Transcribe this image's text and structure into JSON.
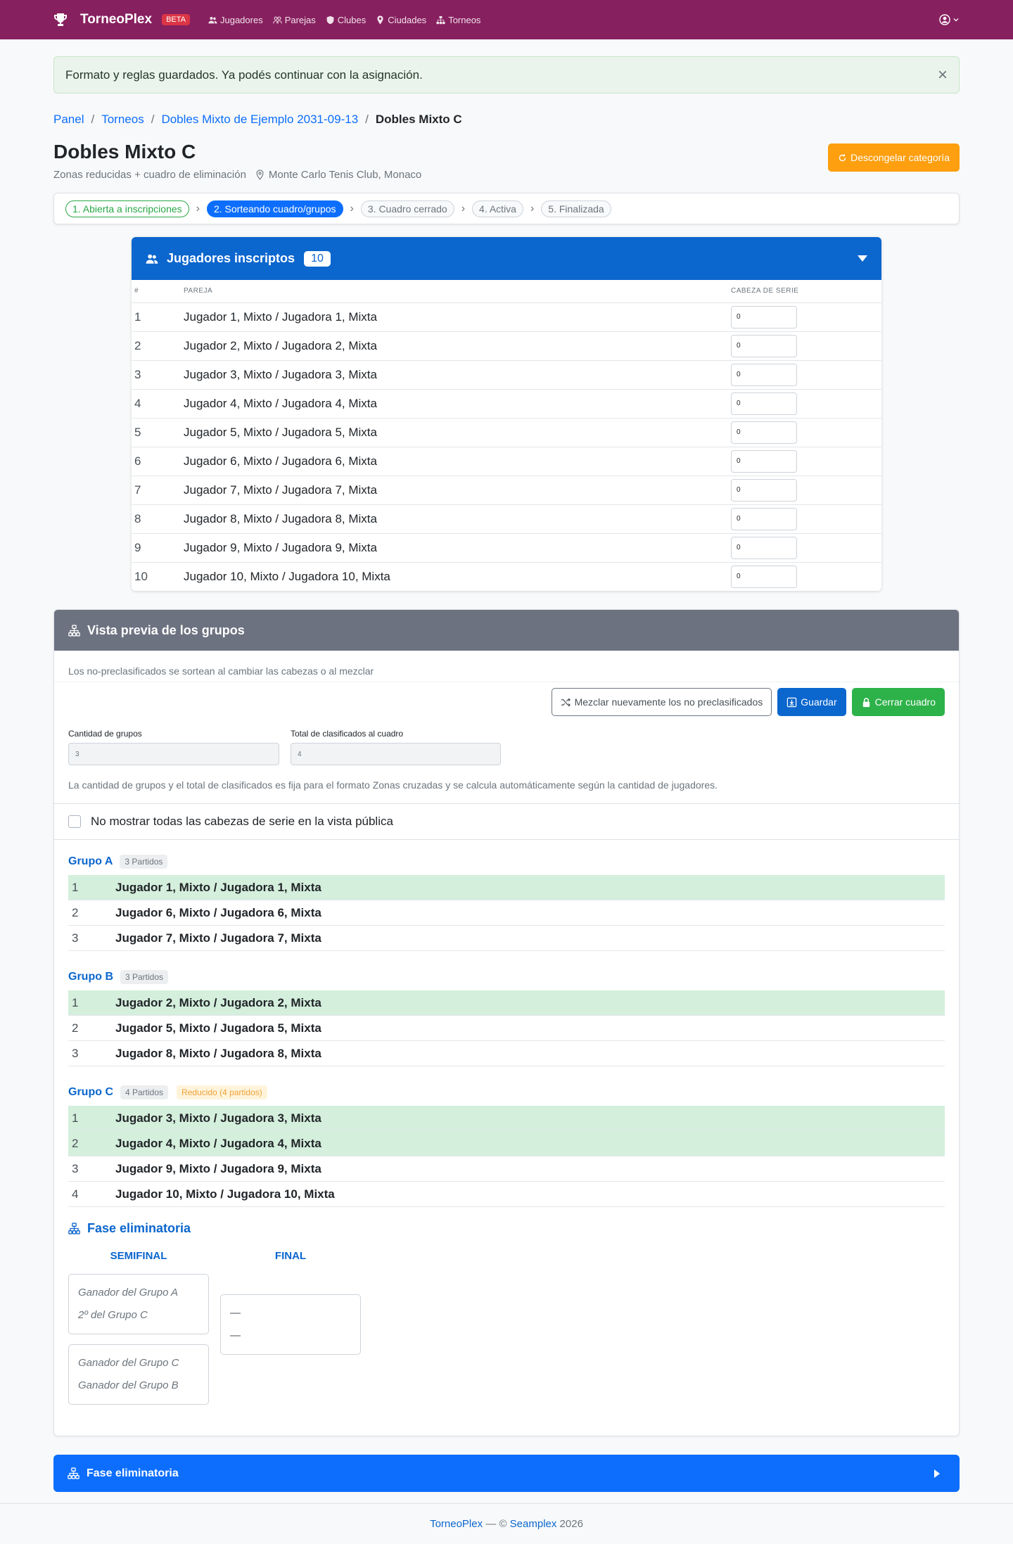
{
  "nav": {
    "brand": "TorneoPlex",
    "beta": "BETA",
    "items": [
      {
        "label": "Jugadores",
        "icon": "people-icon"
      },
      {
        "label": "Parejas",
        "icon": "pair-icon"
      },
      {
        "label": "Clubes",
        "icon": "shield-icon"
      },
      {
        "label": "Ciudades",
        "icon": "pin-icon"
      },
      {
        "label": "Torneos",
        "icon": "bracket-icon"
      }
    ],
    "user_icon": "user-circle-icon"
  },
  "alert": {
    "text": "Formato y reglas guardados. Ya podés continuar con la asignación.",
    "close": "×"
  },
  "breadcrumb": {
    "panel": "Panel",
    "torneos": "Torneos",
    "torneo": "Dobles Mixto de Ejemplo 2031-09-13",
    "current": "Dobles Mixto C",
    "sep": "/"
  },
  "header": {
    "title": "Dobles Mixto C",
    "format": "Zonas reducidas + cuadro de eliminación",
    "venue": "Monte Carlo Tenis Club, Monaco",
    "unfreeze_button": "Descongelar categoría"
  },
  "steps": [
    {
      "label": "1. Abierta a inscripciones",
      "state": "done"
    },
    {
      "label": "2. Sorteando cuadro/grupos",
      "state": "current"
    },
    {
      "label": "3. Cuadro cerrado",
      "state": "pending"
    },
    {
      "label": "4. Activa",
      "state": "pending"
    },
    {
      "label": "5. Finalizada",
      "state": "pending"
    }
  ],
  "players": {
    "title": "Jugadores inscriptos",
    "count": "10",
    "columns": {
      "num": "#",
      "pair": "PAREJA",
      "seed": "CABEZA DE SERIE"
    },
    "rows": [
      {
        "num": "1",
        "pair": "Jugador 1, Mixto / Jugadora 1, Mixta",
        "seed": "0"
      },
      {
        "num": "2",
        "pair": "Jugador 2, Mixto / Jugadora 2, Mixta",
        "seed": "0"
      },
      {
        "num": "3",
        "pair": "Jugador 3, Mixto / Jugadora 3, Mixta",
        "seed": "0"
      },
      {
        "num": "4",
        "pair": "Jugador 4, Mixto / Jugadora 4, Mixta",
        "seed": "0"
      },
      {
        "num": "5",
        "pair": "Jugador 5, Mixto / Jugadora 5, Mixta",
        "seed": "0"
      },
      {
        "num": "6",
        "pair": "Jugador 6, Mixto / Jugadora 6, Mixta",
        "seed": "0"
      },
      {
        "num": "7",
        "pair": "Jugador 7, Mixto / Jugadora 7, Mixta",
        "seed": "0"
      },
      {
        "num": "8",
        "pair": "Jugador 8, Mixto / Jugadora 8, Mixta",
        "seed": "0"
      },
      {
        "num": "9",
        "pair": "Jugador 9, Mixto / Jugadora 9, Mixta",
        "seed": "0"
      },
      {
        "num": "10",
        "pair": "Jugador 10, Mixto / Jugadora 10, Mixta",
        "seed": "0"
      }
    ]
  },
  "preview": {
    "title": "Vista previa de los grupos",
    "hint": "Los no-preclasificados se sortean al cambiar las cabezas o al mezclar",
    "shuffle_button": "Mezclar nuevamente los no preclasificados",
    "save_button": "Guardar",
    "close_button": "Cerrar cuadro",
    "groups_label": "Cantidad de grupos",
    "groups_value": "3",
    "qualified_label": "Total de clasificados al cuadro",
    "qualified_value": "4",
    "help": "La cantidad de grupos y el total de clasificados es fija para el formato Zonas cruzadas y se calcula automáticamente según la cantidad de jugadores.",
    "hide_seeds_label": "No mostrar todas las cabezas de serie en la vista pública",
    "groups": [
      {
        "name": "Grupo A",
        "matches": "3 Partidos",
        "reduced": "",
        "rows": [
          {
            "pos": "1",
            "name": "Jugador 1, Mixto / Jugadora 1, Mixta",
            "qualified": true
          },
          {
            "pos": "2",
            "name": "Jugador 6, Mixto / Jugadora 6, Mixta",
            "qualified": false
          },
          {
            "pos": "3",
            "name": "Jugador 7, Mixto / Jugadora 7, Mixta",
            "qualified": false
          }
        ]
      },
      {
        "name": "Grupo B",
        "matches": "3 Partidos",
        "reduced": "",
        "rows": [
          {
            "pos": "1",
            "name": "Jugador 2, Mixto / Jugadora 2, Mixta",
            "qualified": true
          },
          {
            "pos": "2",
            "name": "Jugador 5, Mixto / Jugadora 5, Mixta",
            "qualified": false
          },
          {
            "pos": "3",
            "name": "Jugador 8, Mixto / Jugadora 8, Mixta",
            "qualified": false
          }
        ]
      },
      {
        "name": "Grupo C",
        "matches": "4 Partidos",
        "reduced": "Reducido (4 partidos)",
        "rows": [
          {
            "pos": "1",
            "name": "Jugador 3, Mixto / Jugadora 3, Mixta",
            "qualified": true
          },
          {
            "pos": "2",
            "name": "Jugador 4, Mixto / Jugadora 4, Mixta",
            "qualified": true
          },
          {
            "pos": "3",
            "name": "Jugador 9, Mixto / Jugadora 9, Mixta",
            "qualified": false
          },
          {
            "pos": "4",
            "name": "Jugador 10, Mixto / Jugadora 10, Mixta",
            "qualified": false
          }
        ]
      }
    ],
    "knockout": {
      "title": "Fase eliminatoria",
      "semifinal_label": "SEMIFINAL",
      "final_label": "FINAL",
      "semifinals": [
        {
          "a": "Ganador del Grupo A",
          "b": "2º del Grupo C"
        },
        {
          "a": "Ganador del Grupo C",
          "b": "Ganador del Grupo B"
        }
      ],
      "final": {
        "a": "—",
        "b": "—"
      }
    }
  },
  "knockout_bar": {
    "title": "Fase eliminatoria"
  },
  "footer": {
    "brand": "TorneoPlex",
    "middle": " — © ",
    "company": "Seamplex",
    "year": " 2026"
  },
  "colors": {
    "navbar": "#87205f",
    "primary": "#0b66ce",
    "success": "#2db24a",
    "warning": "#fd9f0f",
    "qualified_row": "#d4efdc"
  }
}
